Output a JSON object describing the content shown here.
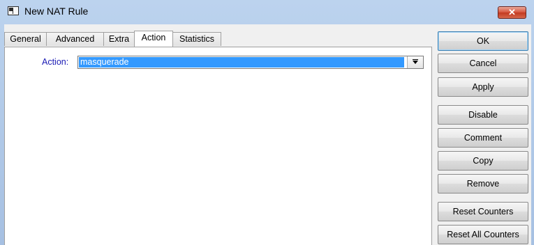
{
  "window": {
    "title": "New NAT Rule",
    "close_label": "✕"
  },
  "tabs": [
    {
      "label": "General",
      "active": false
    },
    {
      "label": "Advanced",
      "active": false
    },
    {
      "label": "Extra",
      "active": false
    },
    {
      "label": "Action",
      "active": true
    },
    {
      "label": "Statistics",
      "active": false
    }
  ],
  "action_field": {
    "label": "Action:",
    "value": "masquerade"
  },
  "buttons": {
    "ok": "OK",
    "cancel": "Cancel",
    "apply": "Apply",
    "disable": "Disable",
    "comment": "Comment",
    "copy": "Copy",
    "remove": "Remove",
    "reset_counters": "Reset Counters",
    "reset_all_counters": "Reset All Counters"
  },
  "colors": {
    "title_bar": "#a9c4e3",
    "selection": "#3399ff",
    "field_label": "#1a1ab4",
    "close_button": "#c9452a"
  }
}
